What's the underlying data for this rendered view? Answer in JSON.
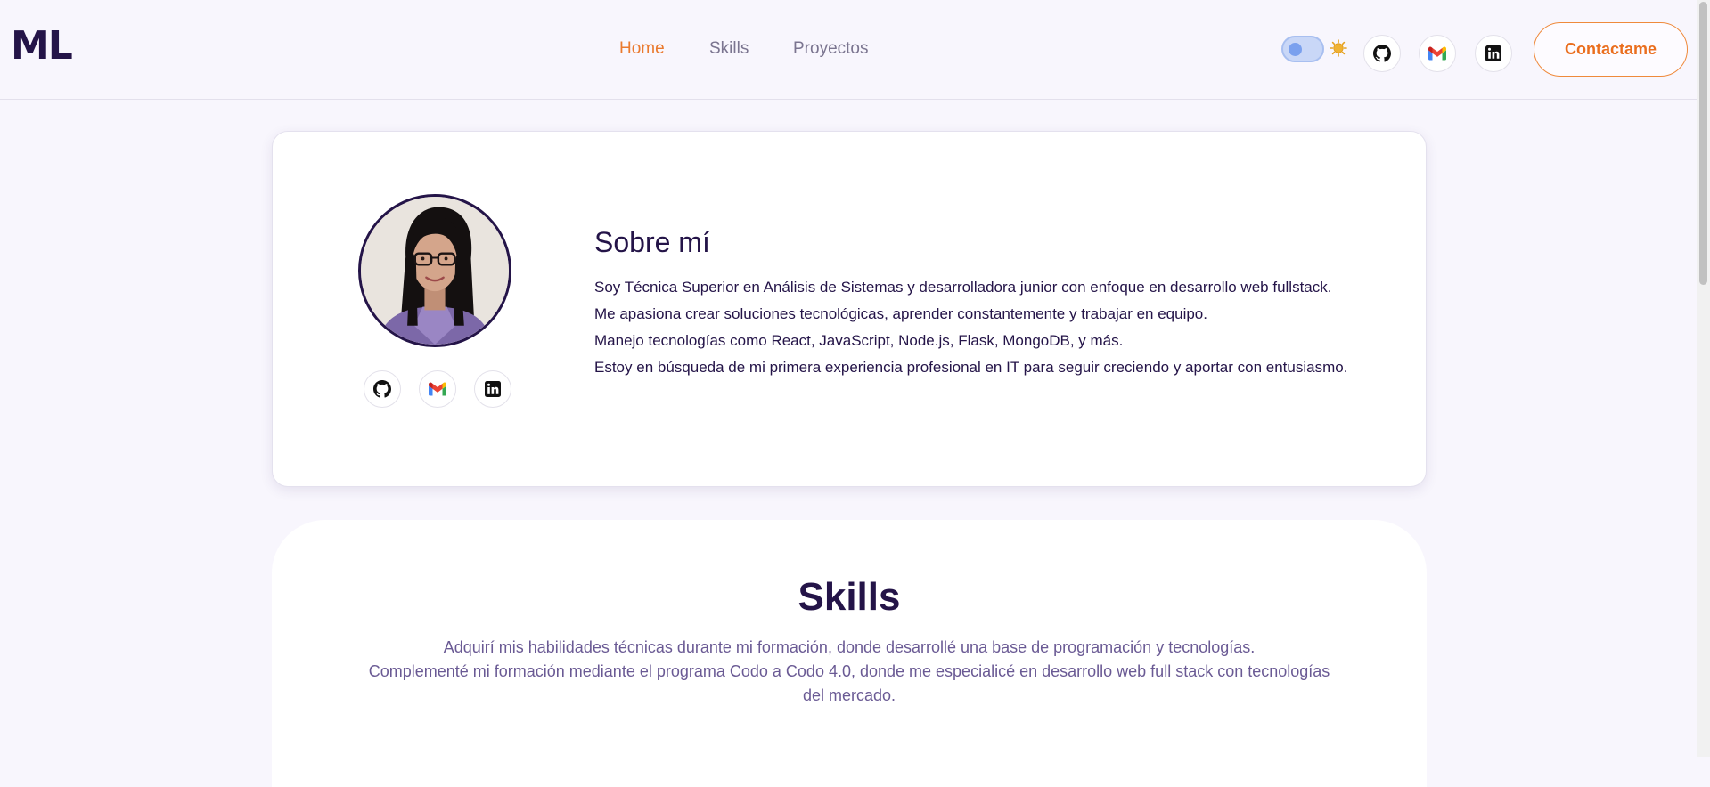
{
  "header": {
    "logo": "ML",
    "nav": [
      {
        "label": "Home",
        "active": true
      },
      {
        "label": "Skills",
        "active": false
      },
      {
        "label": "Proyectos",
        "active": false
      }
    ],
    "contact_label": "Contactame"
  },
  "about": {
    "title": "Sobre mí",
    "paragraphs": [
      "Soy Técnica Superior en Análisis de Sistemas y desarrolladora junior con enfoque en desarrollo web fullstack.",
      "Me apasiona crear soluciones tecnológicas, aprender constantemente y trabajar en equipo.",
      "Manejo tecnologías como React, JavaScript, Node.js, Flask, MongoDB, y más.",
      "Estoy en búsqueda de mi primera experiencia profesional en IT para seguir creciendo y aportar con entusiasmo."
    ]
  },
  "skills": {
    "title": "Skills",
    "lines": [
      "Adquirí mis habilidades técnicas durante mi formación, donde desarrollé una base de programación y tecnologías.",
      "Complementé mi formación mediante el programa Codo a Codo 4.0, donde me especialicé en desarrollo web full stack con tecnologías",
      "del mercado."
    ]
  },
  "icons": {
    "theme_toggle": "toggle-switch",
    "theme": "sun-icon",
    "social": [
      "github-icon",
      "gmail-icon",
      "linkedin-icon"
    ]
  },
  "colors": {
    "accent": "#ea7a2e",
    "primary": "#241448",
    "muted_text": "#6a5a94",
    "background": "#f8f6fd"
  }
}
